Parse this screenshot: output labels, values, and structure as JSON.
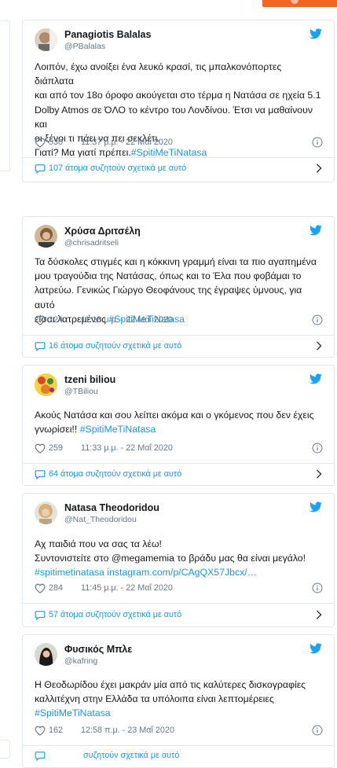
{
  "colors": {
    "accent": "#1b95e0",
    "muted": "#657786",
    "border": "#e1e8ed",
    "orange": "#f26522"
  },
  "icons": {
    "brand": "twitter-bird-icon",
    "like": "heart-icon",
    "info": "info-icon",
    "conversation": "speech-bubble-icon",
    "more": "chevron-right-icon"
  },
  "tweets": [
    {
      "name": "Panagiotis Balalas",
      "handle": "@PBalalas",
      "text_lines": [
        "Λοιπόν, έχω ανοίξει ένα λευκό κρασί, τις μπαλκονόπορτες διάπλατα",
        "και από τον 18ο όροφο ακούγεται στο τέρμα η Νατάσα σε ηχεία 5.1",
        "Dolby Atmos σε ΌΛΟ το κέντρο του Λονδίνου. Έτσι να μαθαίνουν και",
        "οι ξένοι τι πάει να πει σεκλέτι."
      ],
      "text_tail": "Γιατί? Μα γιατί πρέπει.",
      "hashtag": "#SpitiMeTiNatasa",
      "likes": "530",
      "timestamp": "11:37 μ.μ. - 22 Μαΐ 2020",
      "conversation": "107 άτομα συζητούν σχετικά με αυτό"
    },
    {
      "name": "Χρύσα Δριτσέλη",
      "handle": "@chrisadritseli",
      "text_lines": [
        "Τα δύσκολες στιγμές και η κόκκινη γραμμή είναι τα πιο αγαπημένα",
        "μου τραγούδια της Νατάσας, όπως και το Έλα που φοβάμαι το",
        "λατρεύω. Γενικώς Γιώργο Θεοφάνους της έγραψες ύμνους, για αυτό"
      ],
      "text_tail": "είσαι λατρεμένος ",
      "hashtag": "#SpitiMeTiNatasa",
      "likes": "124",
      "timestamp": "11:18 μ.μ. - 22 Μαΐ 2020",
      "conversation": "16 άτομα συζητούν σχετικά με αυτό"
    },
    {
      "name": "tzeni biliou",
      "handle": "@TBiliou",
      "text_lines": [
        "Ακούς Νατάσα και σου λείπει ακόμα και ο γκόμενος που δεν έχεις"
      ],
      "text_tail": "γνωρίσει!! ",
      "hashtag": "#SpitiMeTiNatasa",
      "likes": "259",
      "timestamp": "11:33 μ.μ. - 22 Μαΐ 2020",
      "conversation": "64 άτομα συζητούν σχετικά με αυτό"
    },
    {
      "name": "Natasa Theodoridou",
      "handle": "@Nat_Theodoridou",
      "text_lines": [
        "Αχ παιδιά που να σας τα λέω!",
        "Συντονιστείτε στο @megamemia το βράδυ μας θα είναι μεγάλο!"
      ],
      "text_tail": "",
      "hashtag": "#spitimetinatasa instagram.com/p/CAgQX57Jbcx/…",
      "likes": "284",
      "timestamp": "11:45 μ.μ. - 22 Μαΐ 2020",
      "conversation": "57 άτομα συζητούν σχετικά με αυτό"
    },
    {
      "name": "Φυσικός Μπλε",
      "handle": "@kafring",
      "text_lines": [
        "Η Θεοδωρίδου έχει μακράν μία από τις καλύτερες δισκογραφίες",
        "καλλιτέχνη στην Ελλάδα τα υπόλοιπα είναι λεπτομέρειες"
      ],
      "text_tail": "",
      "hashtag": "#SpitiMeTiNatasa",
      "likes": "162",
      "timestamp": "12:58 π.μ. - 23 Μαΐ 2020",
      "conversation": "συζητούν σχετικά με αυτό"
    }
  ]
}
